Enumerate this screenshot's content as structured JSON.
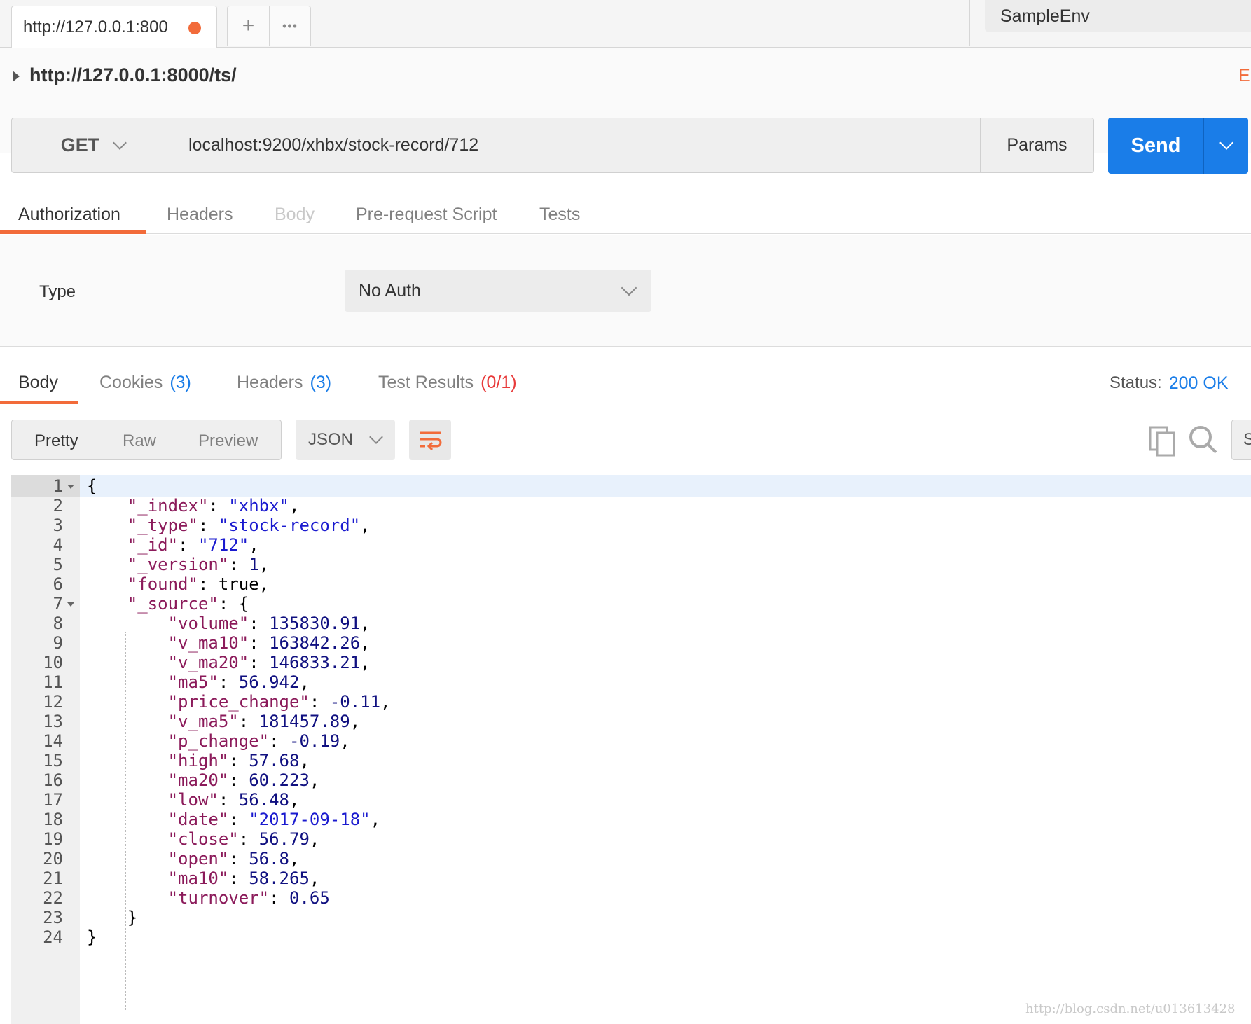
{
  "tab": {
    "title": "http://127.0.0.1:800",
    "unsaved_color": "#f26b3a"
  },
  "tab_actions": {
    "add_label": "+",
    "more_label": "•••"
  },
  "environment": {
    "selected": "SampleEnv"
  },
  "request": {
    "title": "http://127.0.0.1:8000/ts/",
    "examples_link": "E",
    "method": "GET",
    "url": "localhost:9200/xhbx/stock-record/712",
    "params_label": "Params",
    "send_label": "Send"
  },
  "request_tabs": [
    {
      "label": "Authorization",
      "state": "active"
    },
    {
      "label": "Headers",
      "state": "normal"
    },
    {
      "label": "Body",
      "state": "disabled"
    },
    {
      "label": "Pre-request Script",
      "state": "normal"
    },
    {
      "label": "Tests",
      "state": "normal"
    }
  ],
  "auth": {
    "type_label": "Type",
    "type_value": "No Auth"
  },
  "response_tabs": [
    {
      "label": "Body",
      "count": ""
    },
    {
      "label": "Cookies",
      "count": "(3)"
    },
    {
      "label": "Headers",
      "count": "(3)"
    },
    {
      "label": "Test Results",
      "count": "(0/1)"
    }
  ],
  "status": {
    "label": "Status:",
    "value": "200 OK"
  },
  "response_view": {
    "modes": [
      "Pretty",
      "Raw",
      "Preview"
    ],
    "active_mode": "Pretty",
    "format": "JSON",
    "save_label": "S"
  },
  "colors": {
    "accent": "#f26b3a",
    "send": "#1a7de8",
    "status_ok": "#1a7de8",
    "test_fail": "#e83a3a"
  },
  "icons": [
    "chevron-down-icon",
    "wrap-lines-icon",
    "copy-icon",
    "search-icon",
    "caret-right-icon"
  ],
  "code": {
    "lines": [
      [
        [
          "p",
          "{"
        ]
      ],
      [
        [
          "p",
          "    "
        ],
        [
          "k",
          "\"_index\""
        ],
        [
          "p",
          ": "
        ],
        [
          "s",
          "\"xhbx\""
        ],
        [
          "p",
          ","
        ]
      ],
      [
        [
          "p",
          "    "
        ],
        [
          "k",
          "\"_type\""
        ],
        [
          "p",
          ": "
        ],
        [
          "s",
          "\"stock-record\""
        ],
        [
          "p",
          ","
        ]
      ],
      [
        [
          "p",
          "    "
        ],
        [
          "k",
          "\"_id\""
        ],
        [
          "p",
          ": "
        ],
        [
          "s",
          "\"712\""
        ],
        [
          "p",
          ","
        ]
      ],
      [
        [
          "p",
          "    "
        ],
        [
          "k",
          "\"_version\""
        ],
        [
          "p",
          ": "
        ],
        [
          "n",
          "1"
        ],
        [
          "p",
          ","
        ]
      ],
      [
        [
          "p",
          "    "
        ],
        [
          "k",
          "\"found\""
        ],
        [
          "p",
          ": true,"
        ]
      ],
      [
        [
          "p",
          "    "
        ],
        [
          "k",
          "\"_source\""
        ],
        [
          "p",
          ": {"
        ]
      ],
      [
        [
          "p",
          "        "
        ],
        [
          "k",
          "\"volume\""
        ],
        [
          "p",
          ": "
        ],
        [
          "n",
          "135830.91"
        ],
        [
          "p",
          ","
        ]
      ],
      [
        [
          "p",
          "        "
        ],
        [
          "k",
          "\"v_ma10\""
        ],
        [
          "p",
          ": "
        ],
        [
          "n",
          "163842.26"
        ],
        [
          "p",
          ","
        ]
      ],
      [
        [
          "p",
          "        "
        ],
        [
          "k",
          "\"v_ma20\""
        ],
        [
          "p",
          ": "
        ],
        [
          "n",
          "146833.21"
        ],
        [
          "p",
          ","
        ]
      ],
      [
        [
          "p",
          "        "
        ],
        [
          "k",
          "\"ma5\""
        ],
        [
          "p",
          ": "
        ],
        [
          "n",
          "56.942"
        ],
        [
          "p",
          ","
        ]
      ],
      [
        [
          "p",
          "        "
        ],
        [
          "k",
          "\"price_change\""
        ],
        [
          "p",
          ": "
        ],
        [
          "n",
          "-0.11"
        ],
        [
          "p",
          ","
        ]
      ],
      [
        [
          "p",
          "        "
        ],
        [
          "k",
          "\"v_ma5\""
        ],
        [
          "p",
          ": "
        ],
        [
          "n",
          "181457.89"
        ],
        [
          "p",
          ","
        ]
      ],
      [
        [
          "p",
          "        "
        ],
        [
          "k",
          "\"p_change\""
        ],
        [
          "p",
          ": "
        ],
        [
          "n",
          "-0.19"
        ],
        [
          "p",
          ","
        ]
      ],
      [
        [
          "p",
          "        "
        ],
        [
          "k",
          "\"high\""
        ],
        [
          "p",
          ": "
        ],
        [
          "n",
          "57.68"
        ],
        [
          "p",
          ","
        ]
      ],
      [
        [
          "p",
          "        "
        ],
        [
          "k",
          "\"ma20\""
        ],
        [
          "p",
          ": "
        ],
        [
          "n",
          "60.223"
        ],
        [
          "p",
          ","
        ]
      ],
      [
        [
          "p",
          "        "
        ],
        [
          "k",
          "\"low\""
        ],
        [
          "p",
          ": "
        ],
        [
          "n",
          "56.48"
        ],
        [
          "p",
          ","
        ]
      ],
      [
        [
          "p",
          "        "
        ],
        [
          "k",
          "\"date\""
        ],
        [
          "p",
          ": "
        ],
        [
          "s",
          "\"2017-09-18\""
        ],
        [
          "p",
          ","
        ]
      ],
      [
        [
          "p",
          "        "
        ],
        [
          "k",
          "\"close\""
        ],
        [
          "p",
          ": "
        ],
        [
          "n",
          "56.79"
        ],
        [
          "p",
          ","
        ]
      ],
      [
        [
          "p",
          "        "
        ],
        [
          "k",
          "\"open\""
        ],
        [
          "p",
          ": "
        ],
        [
          "n",
          "56.8"
        ],
        [
          "p",
          ","
        ]
      ],
      [
        [
          "p",
          "        "
        ],
        [
          "k",
          "\"ma10\""
        ],
        [
          "p",
          ": "
        ],
        [
          "n",
          "58.265"
        ],
        [
          "p",
          ","
        ]
      ],
      [
        [
          "p",
          "        "
        ],
        [
          "k",
          "\"turnover\""
        ],
        [
          "p",
          ": "
        ],
        [
          "n",
          "0.65"
        ]
      ],
      [
        [
          "p",
          "    }"
        ]
      ],
      [
        [
          "p",
          "}"
        ]
      ]
    ],
    "fold_lines": [
      1,
      7
    ],
    "current_line": 1
  },
  "watermark": "http://blog.csdn.net/u013613428"
}
